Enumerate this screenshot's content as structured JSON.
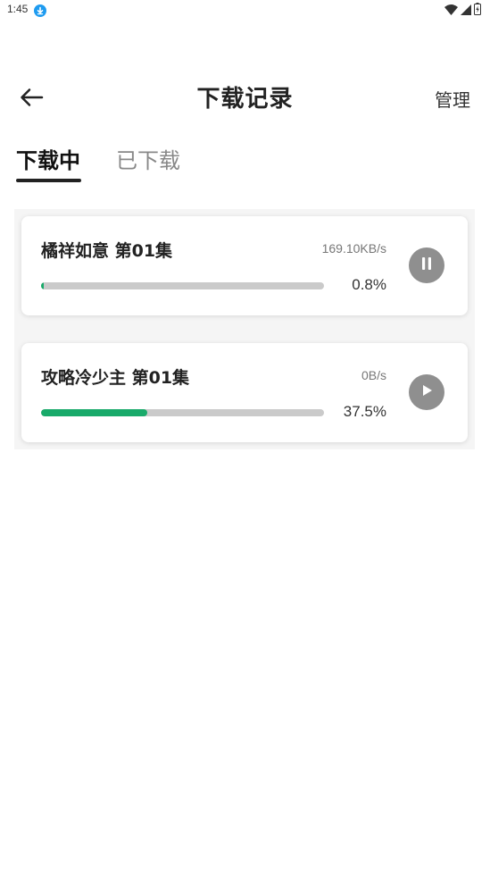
{
  "status_bar": {
    "time": "1:45",
    "icons": [
      "download-notification-icon",
      "wifi-icon",
      "signal-icon",
      "battery-icon"
    ]
  },
  "header": {
    "title": "下载记录",
    "back_icon": "back-arrow-icon",
    "manage_label": "管理"
  },
  "tabs": [
    {
      "label": "下载中",
      "active": true
    },
    {
      "label": "已下载",
      "active": false
    }
  ],
  "downloads": [
    {
      "title": "橘祥如意 第01集",
      "speed": "169.10KB/s",
      "percent_text": "0.8%",
      "progress": 0.008,
      "control_icon": "pause-icon"
    },
    {
      "title": "攻略冷少主 第01集",
      "speed": "0B/s",
      "percent_text": "37.5%",
      "progress": 0.375,
      "control_icon": "play-icon"
    }
  ],
  "colors": {
    "progress_fill": "#19aa6a",
    "progress_track": "#cacaca",
    "control_bg": "#8f8f8f",
    "status_download_icon": "#1e9bf0"
  }
}
